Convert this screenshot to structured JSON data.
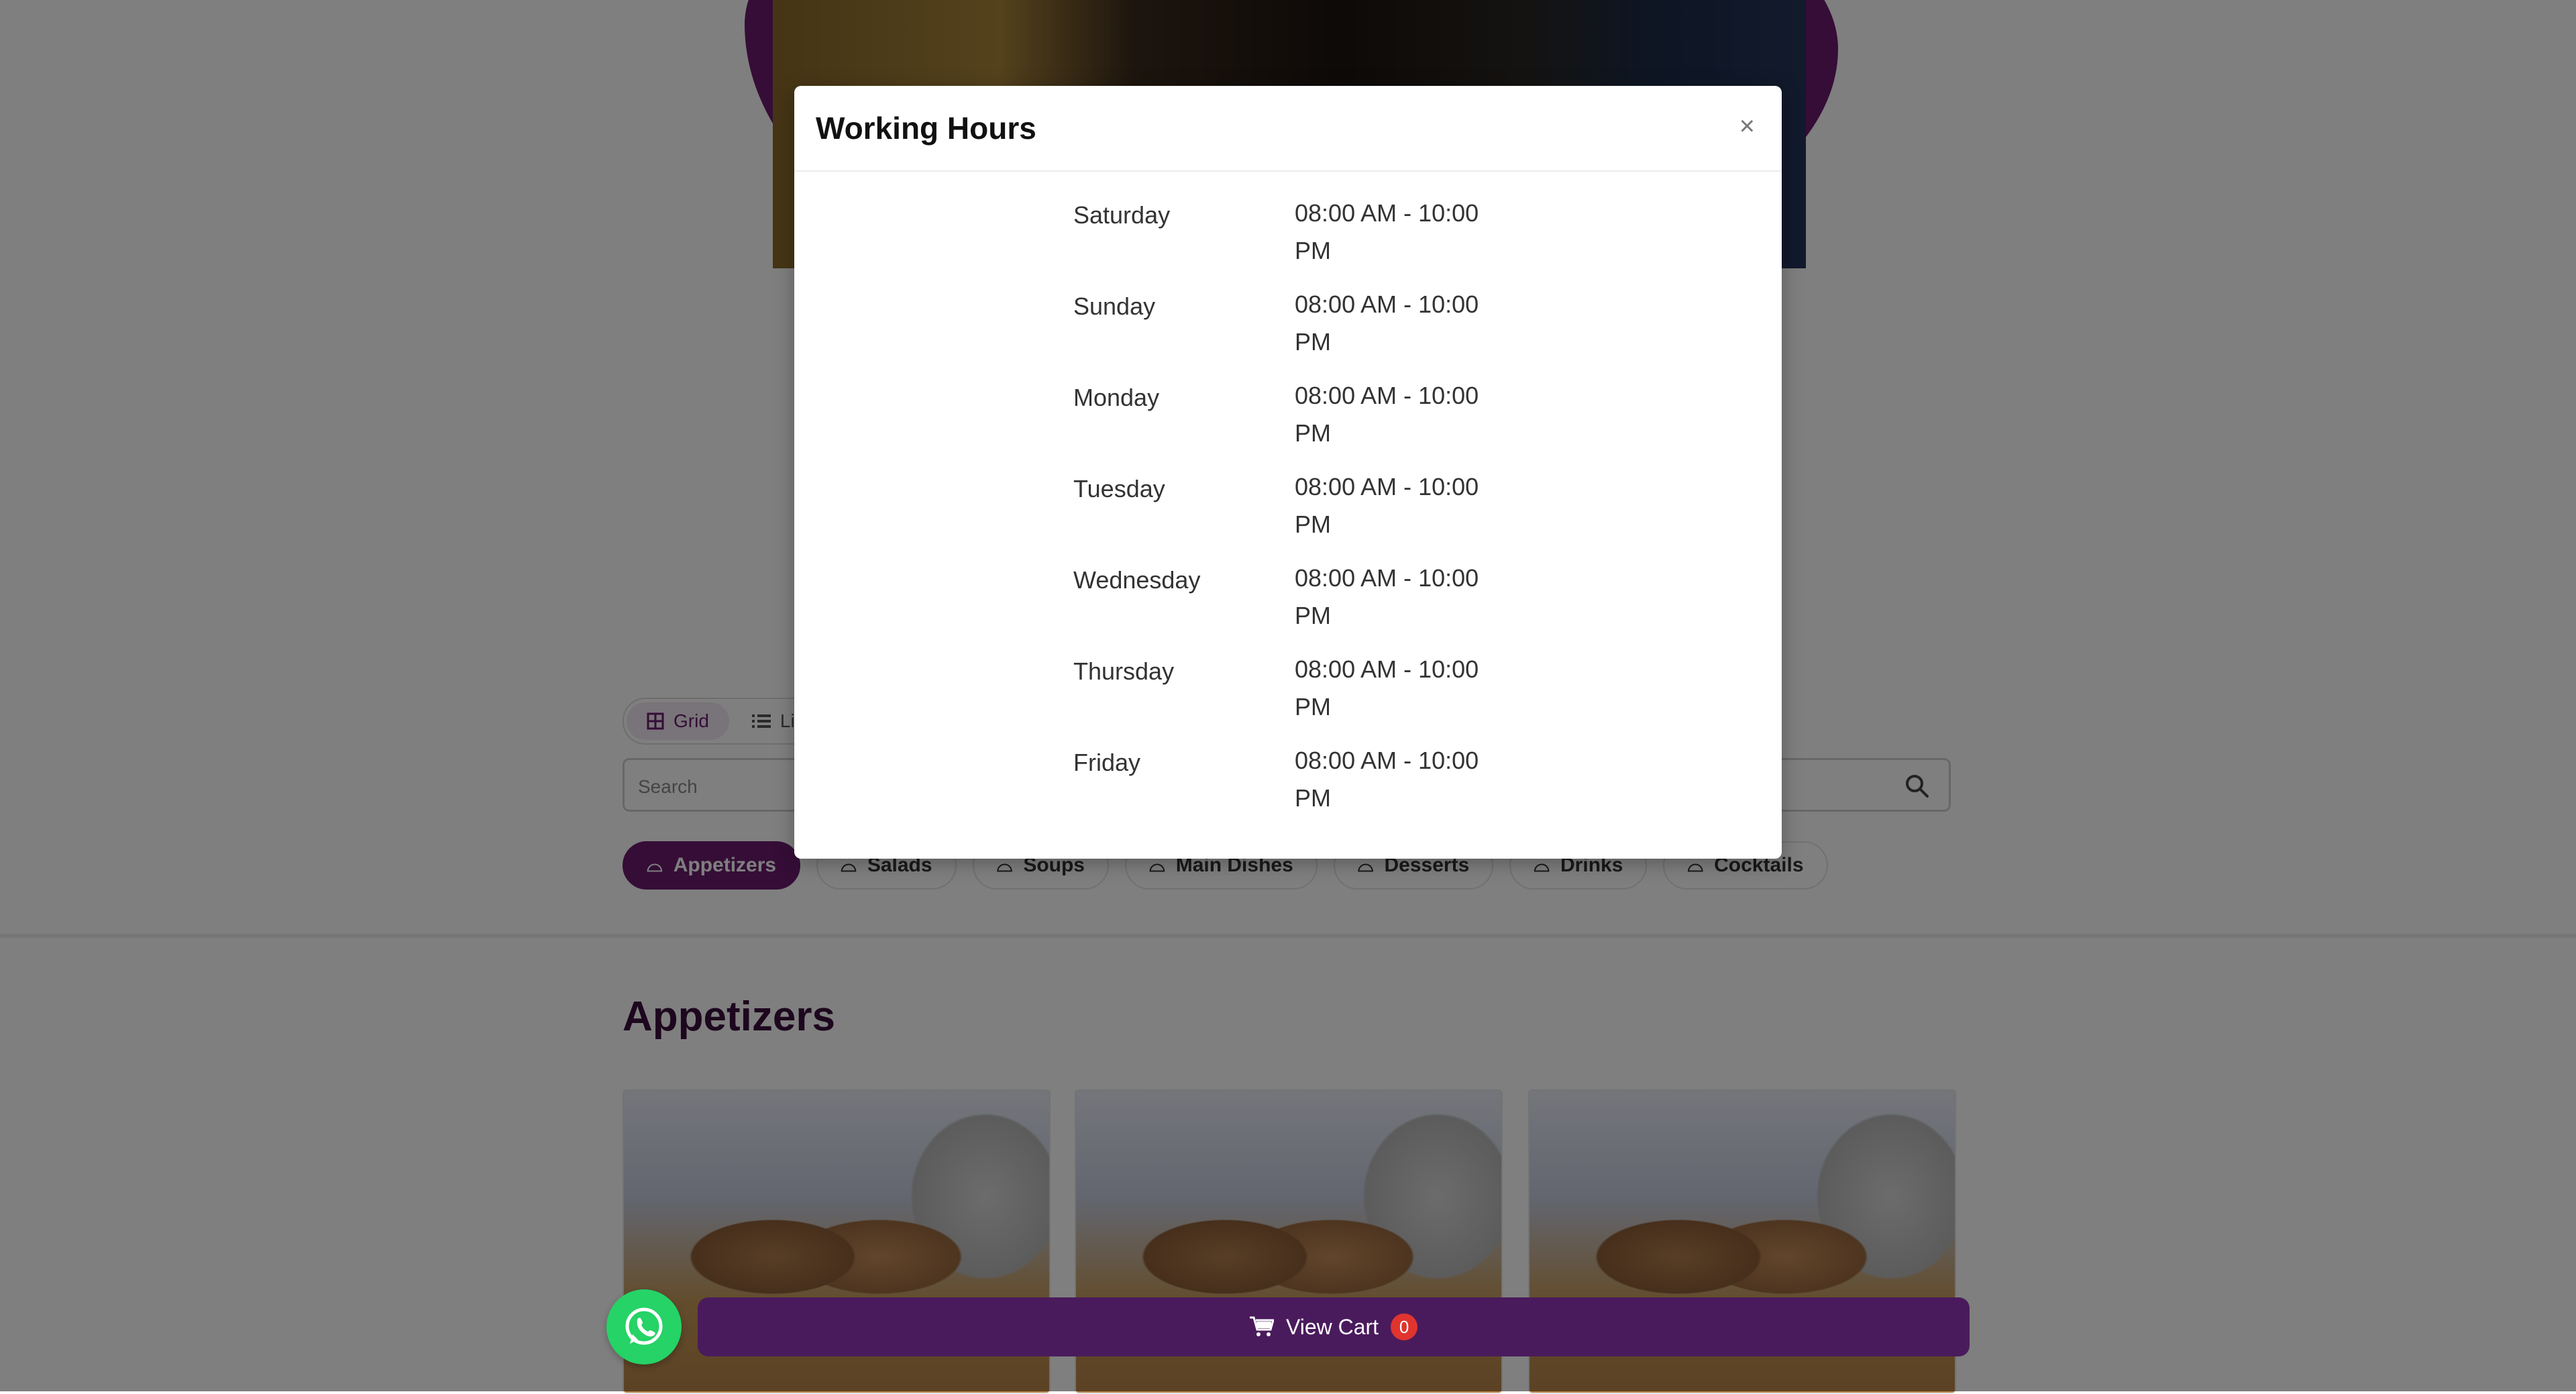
{
  "view_toggle": {
    "grid_label": "Grid",
    "list_label": "List"
  },
  "search": {
    "placeholder": "Search"
  },
  "categories": [
    "Appetizers",
    "Salads",
    "Soups",
    "Main Dishes",
    "Desserts",
    "Drinks",
    "Cocktails"
  ],
  "active_category": "Appetizers",
  "section_title": "Appetizers",
  "cart": {
    "label": "View Cart",
    "count": "0"
  },
  "modal": {
    "title": "Working Hours",
    "close_label": "×",
    "hours": [
      {
        "day": "Saturday",
        "time": "08:00 AM - 10:00 PM"
      },
      {
        "day": "Sunday",
        "time": "08:00 AM - 10:00 PM"
      },
      {
        "day": "Monday",
        "time": "08:00 AM - 10:00 PM"
      },
      {
        "day": "Tuesday",
        "time": "08:00 AM - 10:00 PM"
      },
      {
        "day": "Wednesday",
        "time": "08:00 AM - 10:00 PM"
      },
      {
        "day": "Thursday",
        "time": "08:00 AM - 10:00 PM"
      },
      {
        "day": "Friday",
        "time": "08:00 AM - 10:00 PM"
      }
    ]
  },
  "colors": {
    "brand": "#6b1b6e",
    "cart_bar": "#4a1b5c",
    "whatsapp": "#25d366",
    "badge": "#e0342f"
  }
}
